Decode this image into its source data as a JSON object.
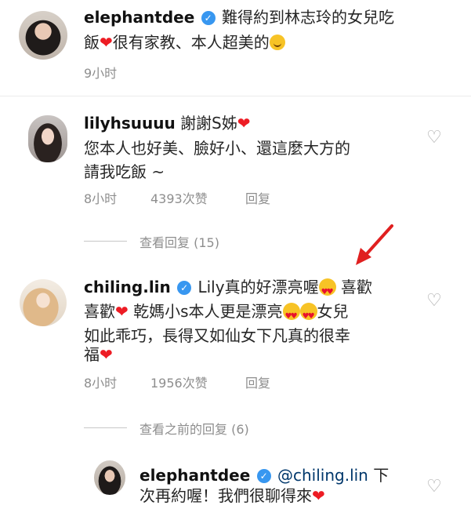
{
  "comments": [
    {
      "username": "elephantdee",
      "line1": "難得約到林志玲的女兒吃",
      "line2": "飯",
      "line2b": "很有家教、本人超美的",
      "time": "9小时"
    },
    {
      "username": "lilyhsuuuu",
      "line1": "謝謝S姊",
      "line2": "您本人也好美、臉好小、還這麼大方的",
      "line3": "請我吃飯 ~",
      "time": "8小时",
      "likes": "4393次赞",
      "reply": "回复",
      "view_replies": "查看回复 (15)"
    },
    {
      "username": "chiling.lin",
      "line1a": "Lily真的好漂亮喔",
      "line1b": "喜歡",
      "line2a": "喜歡",
      "line2b": "乾媽小s本人更是漂亮",
      "line2c": "女兒",
      "line3": "如此乖巧，長得又如仙女下凡真的很幸",
      "line4": "福",
      "time": "8小时",
      "likes": "1956次赞",
      "reply": "回复",
      "view_prev_replies": "查看之前的回复 (6)"
    },
    {
      "username": "elephantdee",
      "mention": "@chiling.lin",
      "line1b": "下",
      "line2": "次再約喔！我們很聊得來"
    }
  ],
  "colors": {
    "heart": "#ed1c24",
    "verified": "#3897f0",
    "arrow": "#e02020",
    "meta": "#8e8e8e"
  }
}
